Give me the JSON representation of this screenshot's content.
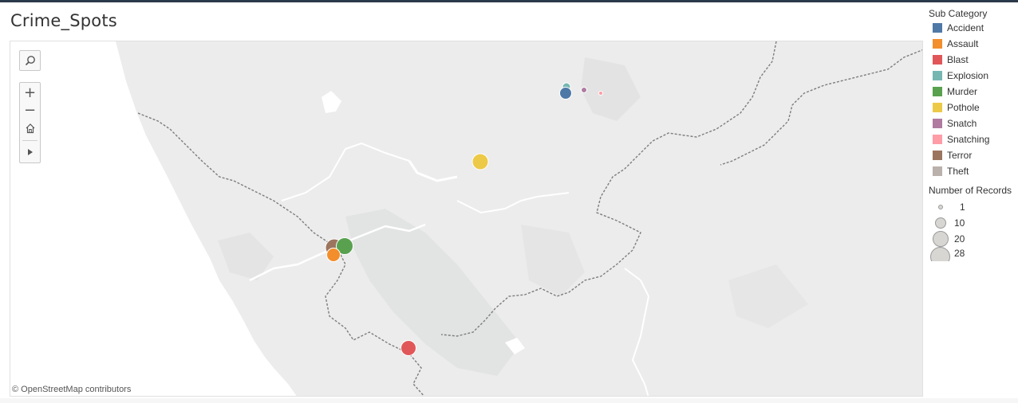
{
  "title": "Crime_Spots",
  "attribution": "© OpenStreetMap contributors",
  "map_controls": {
    "search_icon": "search-icon",
    "zoom_in_label": "+",
    "zoom_out_label": "−",
    "home_icon": "home-icon",
    "play_icon": "play-icon"
  },
  "legend": {
    "color_title": "Sub Category",
    "categories": [
      {
        "label": "Accident",
        "color": "#4e79a7"
      },
      {
        "label": "Assault",
        "color": "#f28e2b"
      },
      {
        "label": "Blast",
        "color": "#e15759"
      },
      {
        "label": "Explosion",
        "color": "#76b7b2"
      },
      {
        "label": "Murder",
        "color": "#59a14f"
      },
      {
        "label": "Pothole",
        "color": "#edc948"
      },
      {
        "label": "Snatch",
        "color": "#b07aa1"
      },
      {
        "label": "Snatching",
        "color": "#ff9da7"
      },
      {
        "label": "Terror",
        "color": "#9c755f"
      },
      {
        "label": "Theft",
        "color": "#bab0ac"
      }
    ],
    "size_title": "Number of Records",
    "sizes": [
      {
        "label": "1",
        "value": 1
      },
      {
        "label": "10",
        "value": 10
      },
      {
        "label": "20",
        "value": 20
      },
      {
        "label": "28",
        "value": 28
      }
    ]
  },
  "points": [
    {
      "category": "Explosion",
      "records": 3
    },
    {
      "category": "Accident",
      "records": 7
    },
    {
      "category": "Snatch",
      "records": 2
    },
    {
      "category": "Snatching",
      "records": 1
    },
    {
      "category": "Pothole",
      "records": 11
    },
    {
      "category": "Terror",
      "records": 17
    },
    {
      "category": "Murder",
      "records": 15
    },
    {
      "category": "Assault",
      "records": 9
    },
    {
      "category": "Blast",
      "records": 10
    }
  ]
}
